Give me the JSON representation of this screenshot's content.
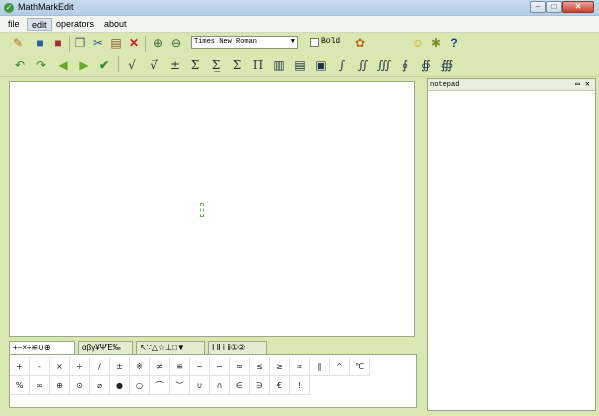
{
  "window": {
    "title": "MathMarkEdit",
    "icon": "app-check-icon",
    "controls": {
      "minimize": "–",
      "maximize": "□",
      "close": "✕"
    }
  },
  "menu": {
    "items": [
      "file",
      "edit",
      "operators",
      "about"
    ],
    "active": "edit"
  },
  "toolbar1": {
    "icons": [
      "edit-pencil-icon",
      "save-icon",
      "save-as-icon",
      "copy-icon",
      "cut-icon",
      "paste-icon",
      "delete-icon",
      "zoom-in-icon",
      "zoom-out-icon",
      "format-icon",
      "smiley-icon",
      "settings-icon",
      "help-icon"
    ],
    "font_value": "Times New Roman",
    "bold_label": "Bold",
    "bold_checked": false,
    "help_glyph": "?"
  },
  "toolbar2": {
    "icons": [
      "undo-icon",
      "redo-icon",
      "back-arrow-icon",
      "forward-arrow-icon",
      "check-icon"
    ],
    "symbols": [
      "√",
      "√̅",
      "±",
      "Σ",
      "Σ̲",
      "Σ",
      "Π",
      "▥",
      "▤",
      "▣",
      "∫",
      "∬",
      "∭",
      "∮",
      "∯",
      "∰"
    ]
  },
  "editor": {
    "content": ""
  },
  "palette": {
    "tabs": [
      "+−×÷≌∪⊕",
      "αβγ¥ΨΈ‰",
      "↖∵△☆⊥□▼",
      "Ⅰ Ⅱ ⅰ ⅱ①②"
    ],
    "active_tab": 0,
    "row1": [
      "+",
      "-",
      "×",
      "÷",
      "/",
      "±",
      "※",
      "≠",
      "≌",
      "~",
      "∽",
      "≈",
      "≤",
      "≥",
      "∝",
      "∥",
      "^",
      "℃"
    ],
    "row2": [
      "%",
      "∞",
      "⊕",
      "⊙",
      "⌀",
      "●",
      "○",
      "⌒",
      "︶",
      "∪",
      "∩",
      "∈",
      "∋",
      "€",
      "!"
    ]
  },
  "notepad": {
    "title": "notepad",
    "float_glyph": "▭",
    "close_glyph": "✕"
  }
}
